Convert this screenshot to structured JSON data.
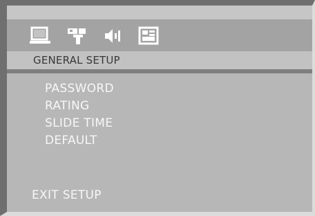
{
  "tabs": [
    {
      "icon": "system-setup-icon"
    },
    {
      "icon": "language-setup-icon"
    },
    {
      "icon": "audio-setup-icon"
    },
    {
      "icon": "preferences-setup-icon"
    }
  ],
  "header": {
    "title": "GENERAL SETUP"
  },
  "menu": {
    "items": [
      {
        "label": "PASSWORD"
      },
      {
        "label": "RATING"
      },
      {
        "label": "SLIDE TIME"
      },
      {
        "label": "DEFAULT"
      }
    ]
  },
  "footer": {
    "exit_label": "EXIT SETUP"
  },
  "colors": {
    "icon_bar": "#a3a3a3",
    "header_bg": "#c2c2c2",
    "content_bg": "#b7b7b7",
    "menu_text": "#f7f7f7"
  }
}
